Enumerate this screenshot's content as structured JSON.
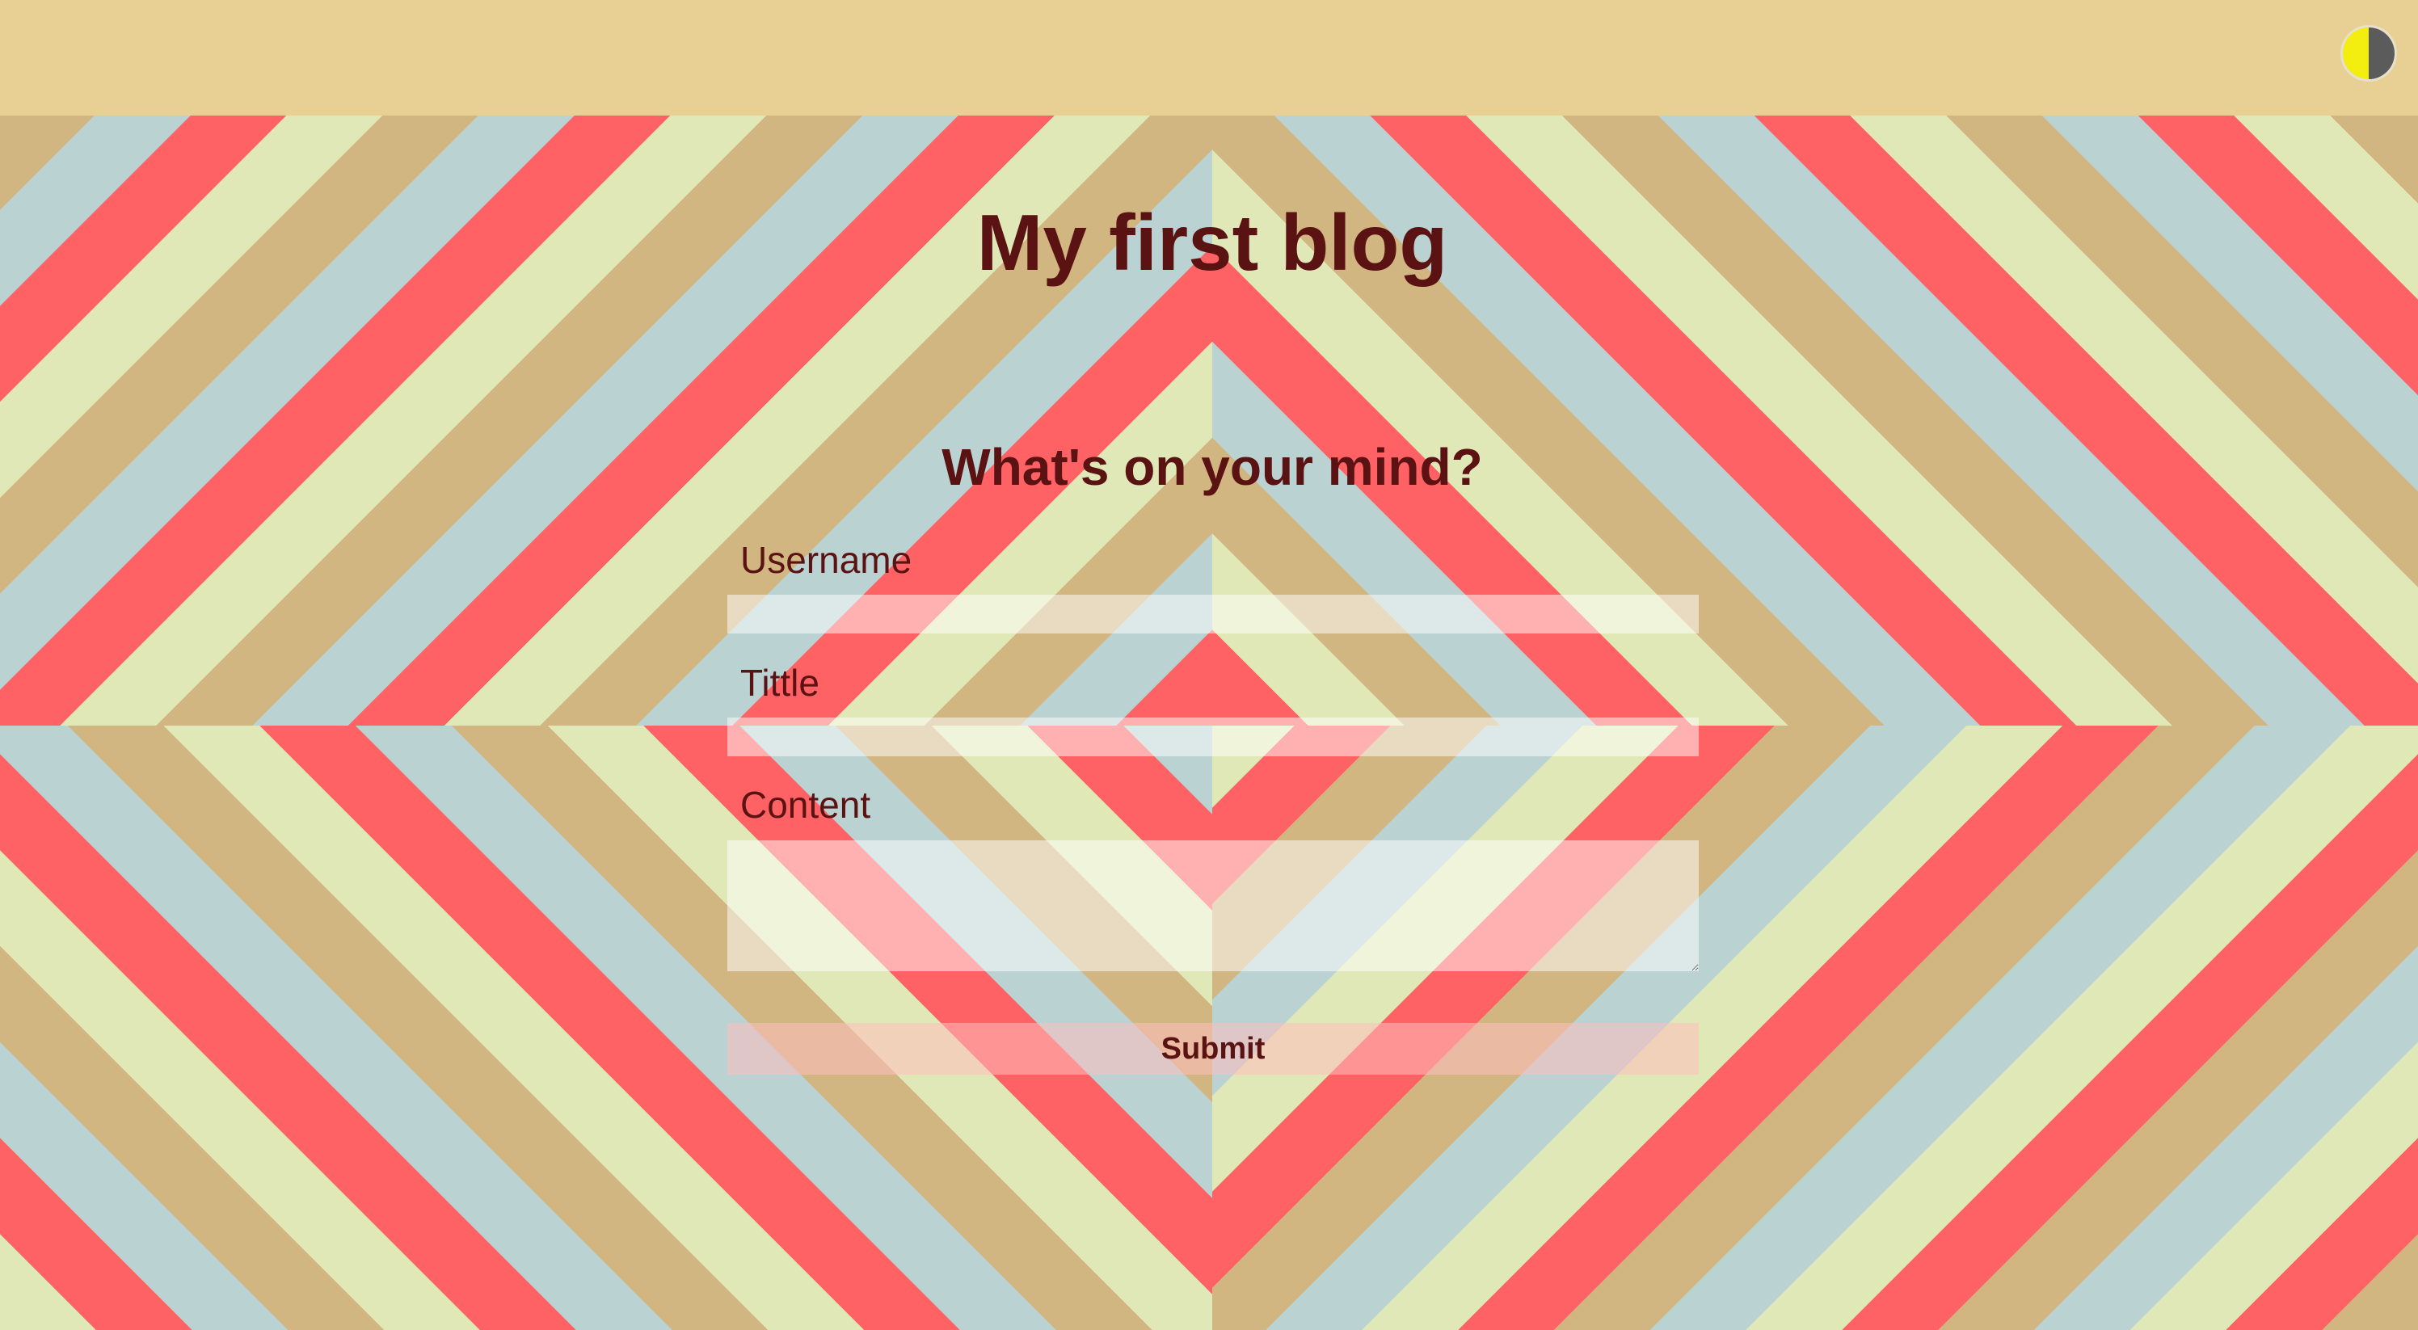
{
  "header": {
    "theme_toggle_icon": "half-moon-contrast-icon",
    "colors": {
      "bar": "#e8cf94",
      "toggle_light": "#f4ee10",
      "toggle_dark": "#5b5b5b"
    }
  },
  "page": {
    "title": "My first blog",
    "background_colors": [
      "#fe6264",
      "#bad3d2",
      "#d2b682",
      "#e1e8b7"
    ],
    "text_color": "#5a1212"
  },
  "form": {
    "heading": "What's on your mind?",
    "username": {
      "label": "Username",
      "value": "",
      "placeholder": ""
    },
    "title": {
      "label": "Tittle",
      "value": "",
      "placeholder": ""
    },
    "content": {
      "label": "Content",
      "value": "",
      "placeholder": ""
    },
    "submit_label": "Submit"
  }
}
